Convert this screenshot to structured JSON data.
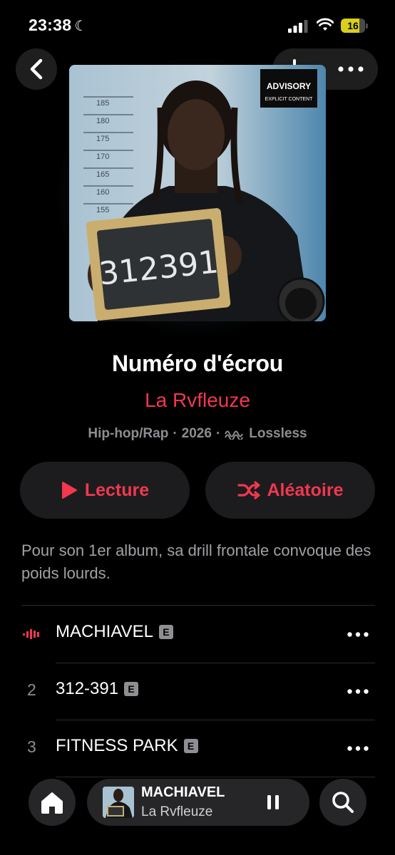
{
  "status_bar": {
    "time": "23:38",
    "battery_level": "16"
  },
  "album": {
    "title": "Numéro d'écrou",
    "artist": "La Rvfleuze",
    "genre": "Hip-hop/Rap",
    "separator": "·",
    "year": "2026",
    "quality": "Lossless",
    "description": "Pour son 1er album, sa drill frontale convoque des poids lourds.",
    "artwork": {
      "sign_text": "312391",
      "height_marks": [
        "185",
        "180",
        "175",
        "170",
        "165",
        "160",
        "155"
      ],
      "advisory_top": "ADVISORY",
      "advisory_bottom": "EXPLICIT CONTENT"
    }
  },
  "actions": {
    "play_label": "Lecture",
    "shuffle_label": "Aléatoire"
  },
  "tracks": [
    {
      "number": "",
      "title": "MACHIAVEL",
      "explicit": "E",
      "playing": true
    },
    {
      "number": "2",
      "title": "312-391",
      "explicit": "E",
      "playing": false
    },
    {
      "number": "3",
      "title": "FITNESS PARK",
      "explicit": "E",
      "playing": false
    }
  ],
  "mini_player": {
    "title": "MACHIAVEL",
    "artist": "La Rvfleuze"
  },
  "colors": {
    "accent": "#f2374f",
    "background": "#000000",
    "secondary_text": "#8d8d92",
    "battery": "#d8cf1c"
  },
  "icons": {
    "back": "chevron-left-icon",
    "add": "plus-icon",
    "more": "ellipsis-icon",
    "play": "play-icon",
    "shuffle": "shuffle-icon",
    "now_playing": "equalizer-icon",
    "home": "home-icon",
    "pause": "pause-icon",
    "search": "search-icon"
  }
}
